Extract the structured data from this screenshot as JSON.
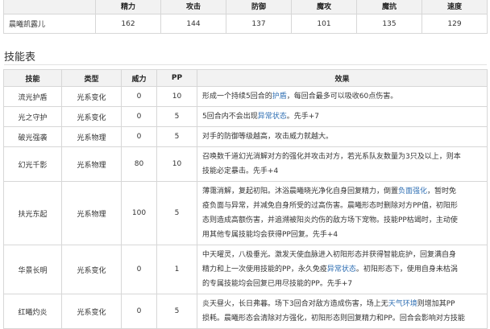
{
  "stats_table": {
    "headers": [
      "",
      "精力",
      "攻击",
      "防御",
      "魔攻",
      "魔抗",
      "速度"
    ],
    "row": [
      "晨曦凯露儿",
      "162",
      "144",
      "137",
      "101",
      "135",
      "129"
    ]
  },
  "section_title": "技能表",
  "skills_table": {
    "headers": [
      "技能",
      "类型",
      "威力",
      "PP",
      "效果"
    ],
    "rows": [
      {
        "name": "流光护盾",
        "type": "光系变化",
        "power": "0",
        "pp": "10",
        "effect": [
          [
            {
              "t": "形成一个持续5回合的"
            },
            {
              "t": "护盾",
              "link": true
            },
            {
              "t": "，每回合最多可以吸收60点伤害。"
            }
          ]
        ]
      },
      {
        "name": "光之守护",
        "type": "光系变化",
        "power": "0",
        "pp": "5",
        "effect": [
          [
            {
              "t": "5回合内不会出现"
            },
            {
              "t": "异常状态",
              "link": true
            },
            {
              "t": "。先手+7"
            }
          ]
        ]
      },
      {
        "name": "破光强袭",
        "type": "光系物理",
        "power": "0",
        "pp": "5",
        "effect": [
          [
            {
              "t": "对手的防御等级越高，攻击威力就越大。"
            }
          ]
        ]
      },
      {
        "name": "幻光千影",
        "type": "光系物理",
        "power": "80",
        "pp": "10",
        "effect": [
          [
            {
              "t": "召唤数千道幻光消解对方的强化并攻击对方，若光系队友数量为3只及以上，则本"
            }
          ],
          [
            {
              "t": "技能必定暴击。先手+4"
            }
          ]
        ]
      },
      {
        "name": "扶光东起",
        "type": "光系物理",
        "power": "100",
        "pp": "5",
        "effect": [
          [
            {
              "t": "薄霭消解，复起初阳。沐浴晨曦晓光净化自身回复精力，倒置"
            },
            {
              "t": "负面强化",
              "link": true
            },
            {
              "t": "，暂时免"
            }
          ],
          [
            {
              "t": "疫负面与异常，并减免自身所受的过高伤害。晨曦形态时删除对方PP值，初阳形"
            }
          ],
          [
            {
              "t": "态则造成高额伤害，并追溯被阳炎灼伤的敌方场下宠物。技能PP枯竭时，主动使"
            }
          ],
          [
            {
              "t": "用其他专属技能均会获得PP回复。先手+4"
            }
          ]
        ]
      },
      {
        "name": "华景长明",
        "type": "光系变化",
        "power": "0",
        "pp": "1",
        "effect": [
          [
            {
              "t": "中天曜灵，八极垂光。激发天使血脉进入初阳形态并获得智能庇护，回复满自身"
            }
          ],
          [
            {
              "t": "精力和上一次使用技能的PP，永久免疫"
            },
            {
              "t": "异常状态",
              "link": true
            },
            {
              "t": "。初阳形态下，使用自身未枯涡"
            }
          ],
          [
            {
              "t": "的专属技能均会回复已用尽技能的PP。先手+7"
            }
          ]
        ]
      },
      {
        "name": "红曦灼炎",
        "type": "光系变化",
        "power": "0",
        "pp": "5",
        "effect": [
          [
            {
              "t": "炎天昼火，长日弗暮。场下3回合对敌方造成伤害，场上无"
            },
            {
              "t": "天气环境",
              "link": true
            },
            {
              "t": "则增加其PP"
            }
          ],
          [
            {
              "t": "损耗。晨曦形态会清除对方强化，初阳形态则回复精力和PP。回合会影响对方技能"
            }
          ]
        ]
      }
    ]
  }
}
